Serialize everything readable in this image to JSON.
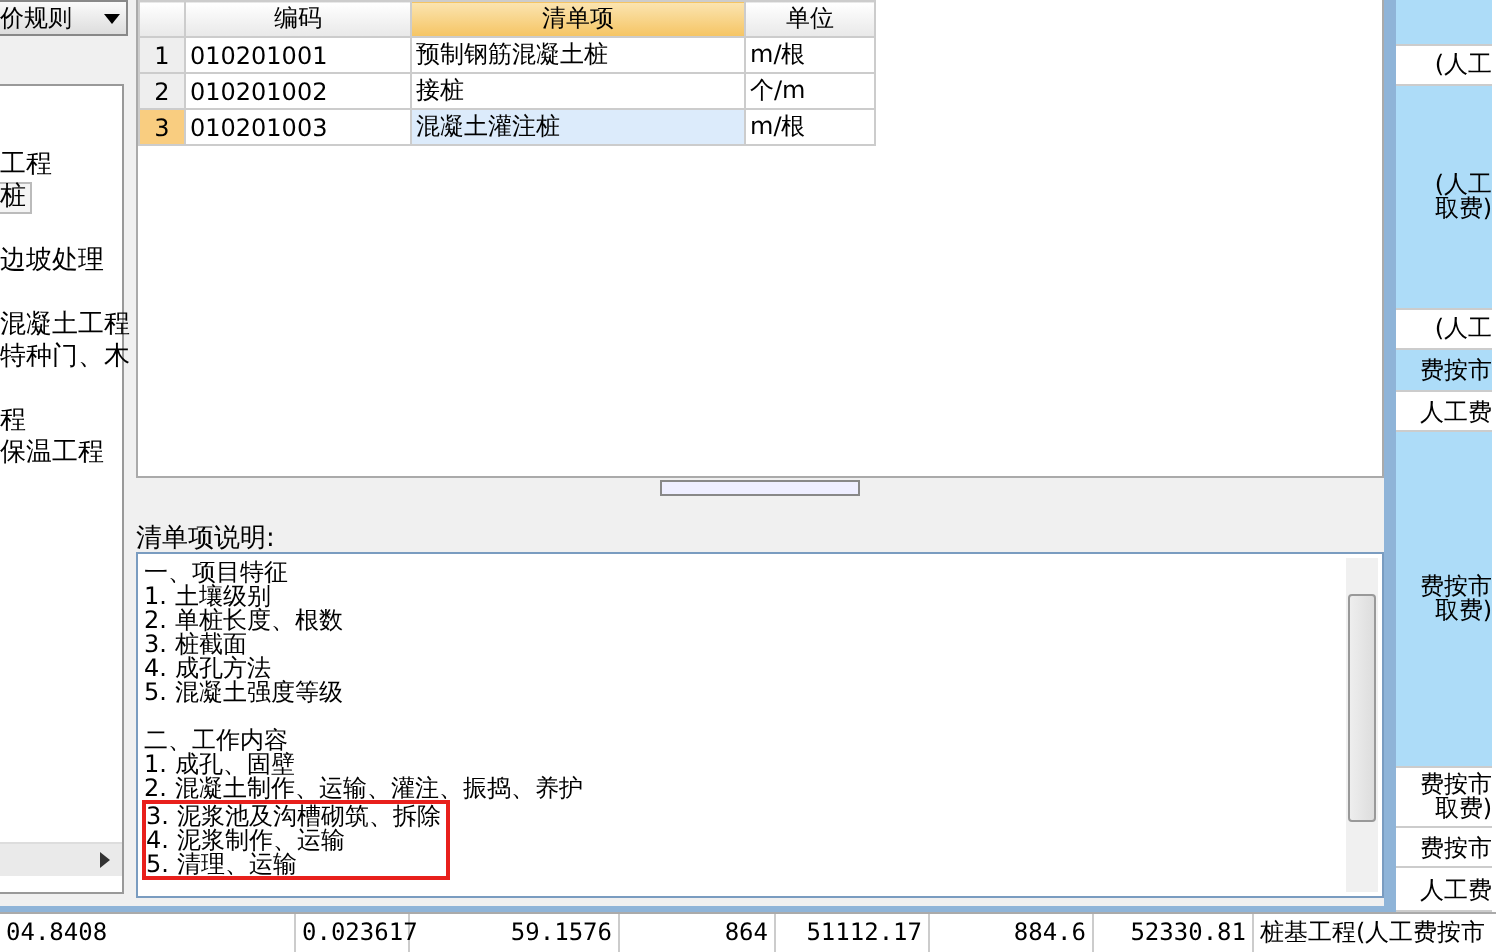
{
  "rule_dropdown": {
    "value": "价规则"
  },
  "tree": {
    "items": [
      {
        "label": "工程",
        "selected": false
      },
      {
        "label": "桩",
        "selected": true
      },
      {
        "label": "边坡处理",
        "selected": false
      },
      {
        "label": "混凝土工程",
        "selected": false
      },
      {
        "label": "特种门、木",
        "selected": false
      },
      {
        "label": "程",
        "selected": false
      },
      {
        "label": "保温工程",
        "selected": false
      }
    ]
  },
  "table": {
    "columns": [
      {
        "label": "编码",
        "sorted": false
      },
      {
        "label": "清单项",
        "sorted": true
      },
      {
        "label": "单位",
        "sorted": false
      }
    ],
    "rows": [
      {
        "index": "1",
        "code": "010201001",
        "item": "预制钢筋混凝土桩",
        "unit": "m/根",
        "selected": false
      },
      {
        "index": "2",
        "code": "010201002",
        "item": "接桩",
        "unit": "个/m",
        "selected": false
      },
      {
        "index": "3",
        "code": "010201003",
        "item": "混凝土灌注桩",
        "unit": "m/根",
        "selected": true
      }
    ]
  },
  "description": {
    "label": "清单项说明:",
    "lines": [
      {
        "text": "一、项目特征",
        "highlighted": false
      },
      {
        "text": "1. 土壤级别",
        "highlighted": false
      },
      {
        "text": "2. 单桩长度、根数",
        "highlighted": false
      },
      {
        "text": "3. 桩截面",
        "highlighted": false
      },
      {
        "text": "4. 成孔方法",
        "highlighted": false
      },
      {
        "text": "5. 混凝土强度等级",
        "highlighted": false
      },
      {
        "text": "二、工作内容",
        "highlighted": false,
        "gap_before": true
      },
      {
        "text": "1. 成孔、固壁",
        "highlighted": false
      },
      {
        "text": "2. 混凝土制作、运输、灌注、振捣、养护",
        "highlighted": false
      },
      {
        "text": "3. 泥浆池及沟槽砌筑、拆除",
        "highlighted": true
      },
      {
        "text": "4. 泥浆制作、运输",
        "highlighted": true
      },
      {
        "text": "5. 清理、运输",
        "highlighted": true
      }
    ]
  },
  "side_column": [
    {
      "highlighted": true
    },
    {
      "lines": [
        "(人工"
      ],
      "highlighted": false
    },
    {
      "lines": [
        "(人工",
        "取费)"
      ],
      "highlighted": true
    },
    {
      "lines": [
        "(人工"
      ],
      "highlighted": false
    },
    {
      "lines": [
        "费按市"
      ],
      "highlighted": true
    },
    {
      "lines": [
        "人工费"
      ],
      "highlighted": false
    },
    {
      "lines": [
        "费按市",
        "取费)"
      ],
      "highlighted": true
    },
    {
      "lines": [
        "费按市",
        "取费)"
      ],
      "highlighted": false
    },
    {
      "lines": [
        "费按市"
      ],
      "highlighted": false
    },
    {
      "lines": [
        "人工费"
      ],
      "highlighted": false
    }
  ],
  "bottom_row": [
    "04.8408",
    "0.023617",
    "59.1576",
    "864",
    "51112.17",
    "884.6",
    "52330.81",
    "桩基工程(人工费按市"
  ]
}
